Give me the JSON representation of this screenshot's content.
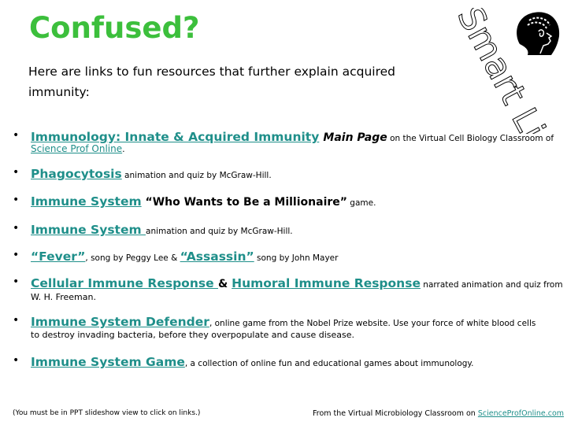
{
  "title": "Confused?",
  "intro": "Here are links to fun resources that further explain acquired immunity:",
  "smart_links_label": "Smart Links",
  "colors": {
    "title": "#3cbf3c",
    "link": "#1f8f8a"
  },
  "items": [
    {
      "link": "Immunology: Innate & Acquired Immunity",
      "bold": "Main Page",
      "text": " on the Virtual Cell Biology Classroom of",
      "sub_link": "Science Prof Online",
      "sub_text": "."
    },
    {
      "link": "Phagocytosis",
      "text": " animation and quiz by McGraw-Hill."
    },
    {
      "link": "Immune System",
      "bold": " “Who Wants to Be a Millionaire”",
      "text": " game."
    },
    {
      "link": "Immune System ",
      "text": " animation and quiz by McGraw-Hill."
    },
    {
      "link": "“Fever”",
      "text": ", song by Peggy Lee & ",
      "link2": "“Assassin”",
      "text2": " song by John Mayer"
    },
    {
      "link": "Cellular Immune Response ",
      "amp": " & ",
      "link2": "Humoral Immune Response",
      "text": " narrated animation and quiz from",
      "sub_text": "W. H. Freeman."
    },
    {
      "link": "Immune System Defender",
      "text": ", online game from the Nobel Prize website. Use your force of white blood cells",
      "sub_text": "to destroy invading bacteria, before they overpopulate and cause disease."
    },
    {
      "link": "Immune System Game",
      "text": ", a collection of online fun and educational games about immunology."
    }
  ],
  "footer": {
    "note": "(You must be in PPT slideshow view to click on links.)",
    "source": "From the  Virtual Microbiology Classroom on ",
    "source_link": "ScienceProfOnline.com"
  }
}
